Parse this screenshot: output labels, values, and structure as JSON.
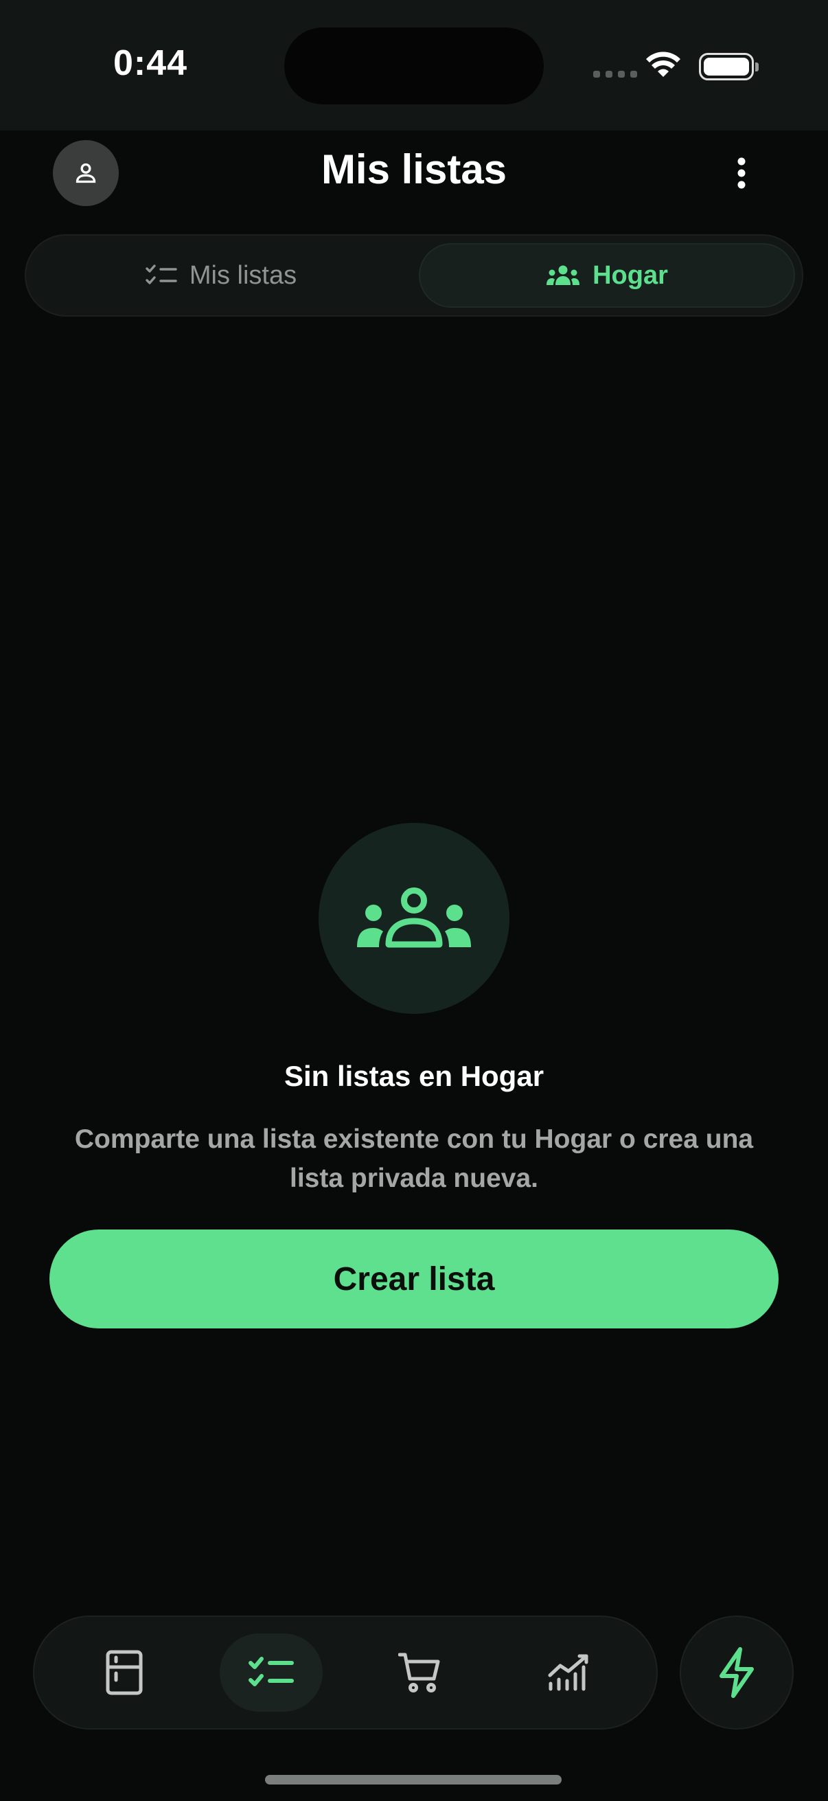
{
  "status_bar": {
    "time": "0:44"
  },
  "header": {
    "title": "Mis listas"
  },
  "tabs": [
    {
      "label": "Mis listas",
      "icon": "checklist-icon",
      "active": false
    },
    {
      "label": "Hogar",
      "icon": "group-icon",
      "active": true
    }
  ],
  "empty_state": {
    "icon": "group-icon",
    "title": "Sin listas en Hogar",
    "description": "Comparte una lista existente con tu Hogar o crea una lista privada nueva.",
    "button_label": "Crear lista"
  },
  "bottom_nav": {
    "items": [
      {
        "icon": "fridge-icon",
        "active": false
      },
      {
        "icon": "checklist-icon",
        "active": true
      },
      {
        "icon": "cart-icon",
        "active": false
      },
      {
        "icon": "chart-icon",
        "active": false
      }
    ],
    "action_icon": "bolt-icon"
  },
  "colors": {
    "accent": "#5ee08f",
    "background": "#080a0a",
    "surface": "#121614"
  }
}
